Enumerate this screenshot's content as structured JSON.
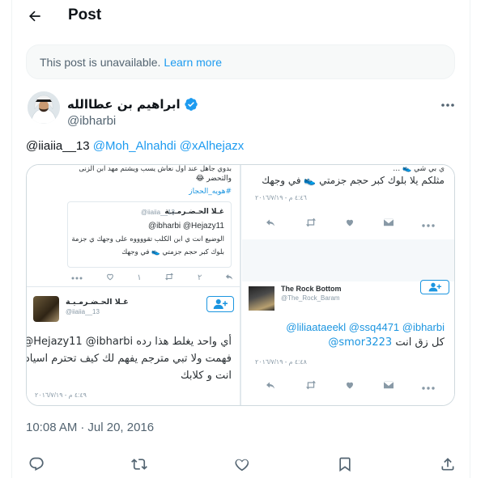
{
  "header": {
    "title": "Post",
    "back_icon": "arrow-left-icon"
  },
  "notice": {
    "text": "This post is unavailable.",
    "link": "Learn more"
  },
  "author": {
    "name": "ابراهيم بن عطاالله",
    "handle": "@ibharbi",
    "verified": true
  },
  "tweet": {
    "reply_to": "@iiaiia__13",
    "mention_1": "@Moh_Alnahdi",
    "mention_2": "@xAlhejazx"
  },
  "media": {
    "left": {
      "top_line_1": "بدوي جاهل عند اول نعاش يسب ويشتم مهد ابن الزنى",
      "top_line_2": "والتحضر 😂",
      "top_hashtag": "#هويه_الحجاز",
      "quote_name": "غـلا الحـضـرمـيـة",
      "quote_handle": "@iiaiia__13",
      "quote_line_1": "@ibharbi @Hejazy11",
      "quote_line_2": "الوضيع انت ي ابن الكلب تقووووه على وجهك ي جزمة",
      "quote_line_3": "بلوك كبر حجم جزمتي 👟 في وجهك",
      "retweets": "٢",
      "likes": "١",
      "author_name": "غـلا الحـضـرمـيـة",
      "author_handle": "@iiaiia__13",
      "body_line_1": "@Hejazy11 @ibharbi أي واحد يغلط هذا رده",
      "body_line_2": "فهمت ولا تبي مترجم يفهم لك كيف تحترم اسيادك",
      "body_line_3": "انت و كلابك",
      "timestamp": "٤:٤٩ م - ٢٠١٦/٧/١٩"
    },
    "right": {
      "top_line_1": "ي بي شي 👟 …",
      "top_line_2": "مثلكم يلا بلوك كبر حجم جزمتي 👟 في وجهك",
      "timestamp_1": "٤:٤٦ م - ٢٠١٦/٧/١٩",
      "author_name": "The Rock Bottom",
      "author_handle": "@The_Rock_Baram",
      "body_line_1": "@liliaataeekl @ssq4471 @ibharbi",
      "body_mention": "@smor3223",
      "body_text": "كل زق انت",
      "timestamp_2": "٤:٤٨ م - ٢٠١٦/٧/١٩"
    }
  },
  "meta": {
    "time": "10:08 AM",
    "date": "Jul 20, 2016"
  },
  "actions": [
    "reply-icon",
    "retweet-icon",
    "like-icon",
    "bookmark-icon",
    "share-icon"
  ]
}
